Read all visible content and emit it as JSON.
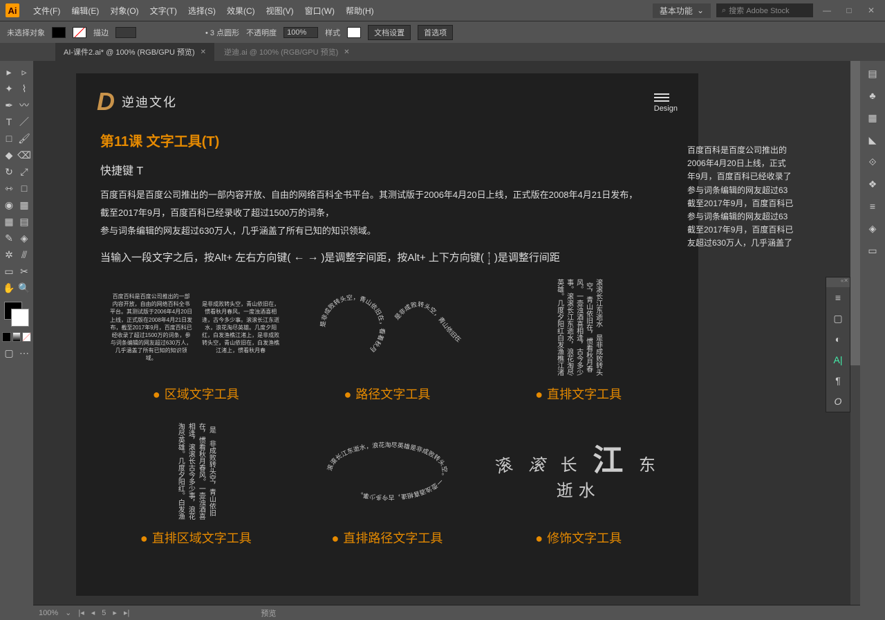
{
  "app": {
    "logo": "Ai"
  },
  "menus": [
    "文件(F)",
    "编辑(E)",
    "对象(O)",
    "文字(T)",
    "选择(S)",
    "效果(C)",
    "视图(V)",
    "窗口(W)",
    "帮助(H)"
  ],
  "titlebar": {
    "workspace": "基本功能",
    "search_placeholder": "搜索 Adobe Stock"
  },
  "controlbar": {
    "status": "未选择对象",
    "stroke_label": "描边",
    "stroke_weight": "3",
    "stroke_style": "点圆形",
    "opacity_label": "不透明度",
    "opacity_value": "100%",
    "style_label": "样式",
    "btn1": "文档设置",
    "btn2": "首选项"
  },
  "tabs": [
    {
      "name": "AI-课件2.ai* @ 100% (RGB/GPU 预览)",
      "active": true
    },
    {
      "name": "逆迪.ai @ 100% (RGB/GPU 预览)",
      "active": false
    }
  ],
  "artboard": {
    "logo_text": "逆迪文化",
    "design_label": "Design",
    "lesson_title": "第11课   文字工具(T)",
    "shortcut": "快捷键 T",
    "para1": "百度百科是百度公司推出的一部内容开放、自由的网络百科全书平台。其测试版于2006年4月20日上线，正式版在2008年4月21日发布，",
    "para2": "截至2017年9月，百度百科已经录收了超过1500万的词条，",
    "para3": "参与词条编辑的网友超过630万人，几乎涵盖了所有已知的知识领域。",
    "tip_a": "当输入一段文字之后，按Alt+ 左右方向键(",
    "tip_b": ")是调整字间距，按Alt+ 上下方向键(",
    "tip_c": ")是调整行间距",
    "small_block1": "百度百科是百度公司推出的一部内容开放，自由的网络百科全书平台。其测试版于2006年4月20日上线，正式版在2008年4月21日发布，截至2017年9月，百度百科已经收录了超过1500万的词条，参与词条编辑的网友超过630万人，几乎涵盖了所有已知的知识领域。",
    "small_block2": "是非成败转头空，青山依旧在，惯看秋月春风。一度浊酒喜相逢，古今多少事。滚滚长江东逝水，浪花淘尽英雄。几度夕阳红，白发渔樵江渚上，是非成败转头空，青山依旧在，白发渔樵江渚上，惯看秋月春",
    "circle_text": "是非成败转头空，青山依旧在，看着秋月",
    "wave_text": "是非成败转头空，青山依旧在",
    "vert_text": "滚滚长江东逝水　是非成败转头空，青山依旧在，惯看秋月春风。一壶浊酒喜相逢，古今多少事。滚滚长江东逝水，浪花淘尽英雄。几度夕阳红白发渔樵江渚",
    "label1": "区域文字工具",
    "label2": "路径文字工具",
    "label3": "直排文字工具",
    "vert_block2": "是　非成败转头空，青山依旧在，惯看秋月春风。一壶浊酒喜相逢，滚滚长古今多少事，浪花淘尽英雄。几度夕阳红。白发渔",
    "ellipse_text": "滚滚长江东逝水，浪花淘尽英雄是非成败转头空。一壶浊酒喜相逢，古今多少事。",
    "styled_text": "滚滚长江东逝水",
    "label4": "直排区域文字工具",
    "label5": "直排路径文字工具",
    "label6": "修饰文字工具"
  },
  "overflow_lines": [
    "百度百科是百度公司推出的",
    "2006年4月20日上线，正式",
    "年9月，百度百科已经收录了",
    "参与词条编辑的网友超过63",
    "截至2017年9月，百度百科已",
    "参与词条编辑的网友超过63",
    "截至2017年9月，百度百科已",
    "友超过630万人，几乎涵盖了"
  ],
  "statusbar": {
    "zoom": "100%",
    "page": "5",
    "mode": "预览"
  },
  "colors": {
    "accent": "#e68a00",
    "artboard_bg": "#1f1f1f",
    "ui_bg": "#535353"
  }
}
